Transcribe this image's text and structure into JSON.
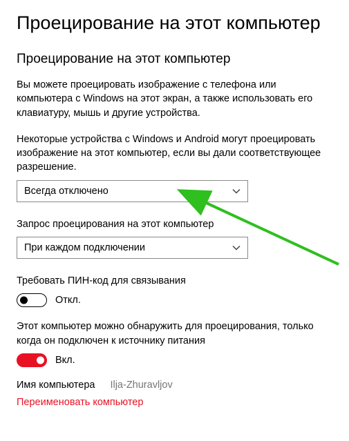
{
  "page_title": "Проецирование на этот компьютер",
  "section_title": "Проецирование на этот компьютер",
  "intro_text": "Вы можете проецировать изображение с телефона или компьютера с Windows на этот экран, а также использовать его клавиатуру, мышь и другие устройства.",
  "permission_label": "Некоторые устройства с Windows и Android могут проецировать изображение на этот компьютер, если вы дали соответствующее разрешение.",
  "permission_dropdown": "Всегда отключено",
  "request_label": "Запрос проецирования на этот компьютер",
  "request_dropdown": "При каждом подключении",
  "pin_label": "Требовать ПИН-код для связывания",
  "pin_toggle_state": "Откл.",
  "discover_label": "Этот компьютер можно обнаружить для проецирования, только когда он подключен к источнику питания",
  "discover_toggle_state": "Вкл.",
  "computer_name_label": "Имя компьютера",
  "computer_name_value": "Ilja-Zhuravljov",
  "rename_link": "Переименовать компьютер"
}
